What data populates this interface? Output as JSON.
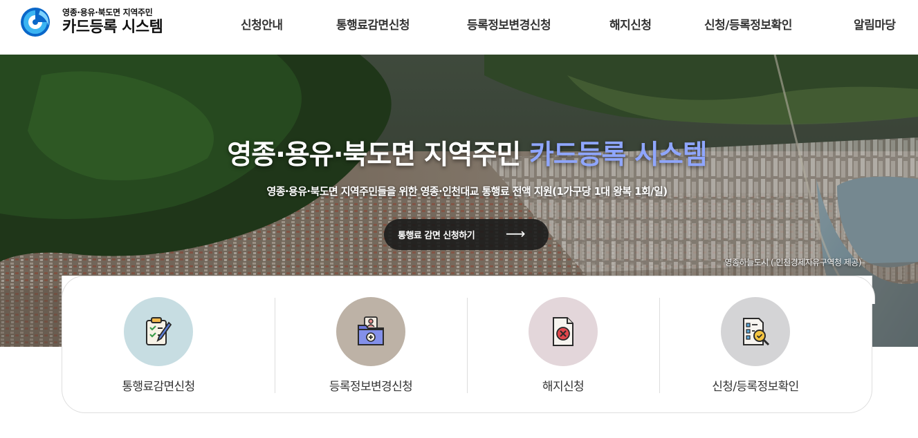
{
  "header": {
    "logo_sub": "영종·용유·북도면 지역주민",
    "logo_main": "카드등록 시스템",
    "nav": [
      {
        "label": "신청안내"
      },
      {
        "label": "통행료감면신청"
      },
      {
        "label": "등록정보변경신청"
      },
      {
        "label": "해지신청"
      },
      {
        "label": "신청/등록정보확인"
      },
      {
        "label": "알림마당"
      }
    ]
  },
  "hero": {
    "title_main": "영종·용유·북도면 지역주민 ",
    "title_accent": "카드등록 시스템",
    "description": "영종·용유·북도면 지역주민들을 위한 영종·인천대교 통행료 전액 지원(1가구당 1대 왕복 1회/일)",
    "button_label": "통행료 감면 신청하기",
    "button_arrow": "⟶",
    "credit": "영종하늘도시 ( 인천경제자유구역청 제공)"
  },
  "quick_menu": [
    {
      "label": "통행료감면신청",
      "icon": "clipboard-checklist-icon",
      "color": "#c7dde2"
    },
    {
      "label": "등록정보변경신청",
      "icon": "folder-user-add-icon",
      "color": "#bdb2a6"
    },
    {
      "label": "해지신청",
      "icon": "document-cancel-icon",
      "color": "#e3d6da"
    },
    {
      "label": "신청/등록정보확인",
      "icon": "document-search-check-icon",
      "color": "#d4d4d6"
    }
  ],
  "colors": {
    "accent": "#8fa6ff",
    "logo_blue": "#0a67c9"
  }
}
